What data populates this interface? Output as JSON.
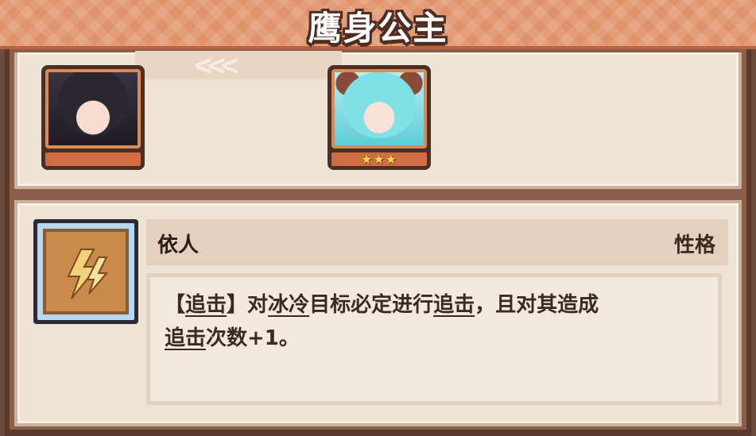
{
  "header": {
    "title": "鹰身公主"
  },
  "evolution": {
    "from_portrait": "character-dark-hair",
    "arrow": "<<<",
    "to_portrait": "character-cyan-hair",
    "to_stars": "★★★",
    "star_count": 3
  },
  "trait": {
    "icon": "lightning-claw-icon",
    "name": "依人",
    "type": "性格",
    "description": {
      "p1": "【",
      "k1": "追击",
      "p2": "】对",
      "k2": "冰冷",
      "p3": "目标必定进行",
      "k3": "追击",
      "p4": "，且对其造成",
      "k4": "追击",
      "p5": "次数+1。"
    }
  },
  "colors": {
    "banner": "#e0936a",
    "panel": "#efe3d6",
    "frame": "#8a5e48",
    "text": "#3a2a22",
    "star": "#ffd84a"
  }
}
